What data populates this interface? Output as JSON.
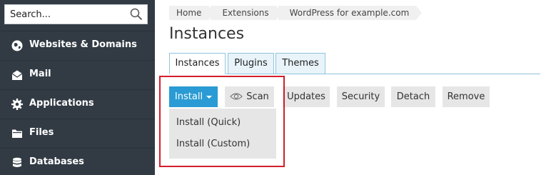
{
  "sidebar": {
    "search": {
      "placeholder": "Search..."
    },
    "items": [
      {
        "label": "Websites & Domains",
        "icon": "globe-icon"
      },
      {
        "label": "Mail",
        "icon": "envelope-icon"
      },
      {
        "label": "Applications",
        "icon": "gear-icon"
      },
      {
        "label": "Files",
        "icon": "folder-icon"
      },
      {
        "label": "Databases",
        "icon": "database-icon"
      }
    ]
  },
  "breadcrumb": [
    "Home",
    "Extensions",
    "WordPress for example.com"
  ],
  "page_title": "Instances",
  "tabs": [
    {
      "label": "Instances",
      "active": true
    },
    {
      "label": "Plugins",
      "active": false
    },
    {
      "label": "Themes",
      "active": false
    }
  ],
  "toolbar": {
    "install": "Install",
    "scan": "Scan",
    "updates": "Updates",
    "security": "Security",
    "detach": "Detach",
    "remove": "Remove"
  },
  "install_menu": [
    "Install (Quick)",
    "Install (Custom)"
  ],
  "colors": {
    "sidebar_bg": "#323b44",
    "primary_button": "#2a9bd4",
    "highlight": "#d21f2b",
    "tab_border": "#8fc4dd"
  }
}
